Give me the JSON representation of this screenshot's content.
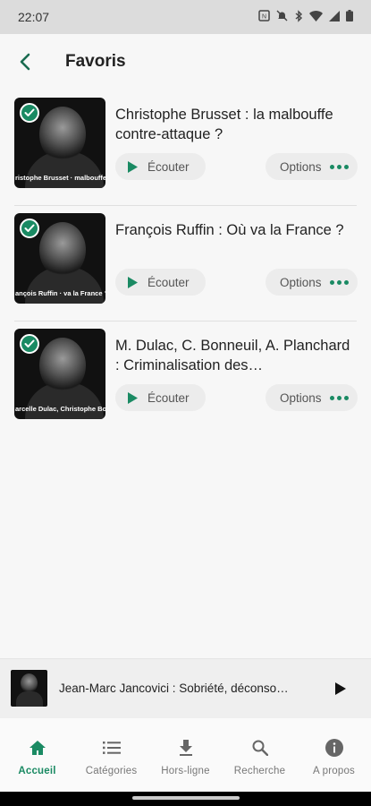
{
  "status": {
    "time": "22:07"
  },
  "header": {
    "title": "Favoris"
  },
  "items": [
    {
      "title": "Christophe Brusset : la malbouffe contre-attaque ?",
      "thumb_caption": "ristophe Brusset · malbouffe contre-attaque ?",
      "listen_label": "Écouter",
      "options_label": "Options"
    },
    {
      "title": "François Ruffin : Où va la France ?",
      "thumb_caption": "ançois Ruffin · va la France ?",
      "listen_label": "Écouter",
      "options_label": "Options"
    },
    {
      "title": "M. Dulac, C. Bonneuil, A. Planchard : Criminalisation des…",
      "thumb_caption": "arcelle Dulac, Christophe Bonneuil et Adé · des luttes écologistes ?",
      "listen_label": "Écouter",
      "options_label": "Options"
    }
  ],
  "player": {
    "title": "Jean-Marc Jancovici : Sobriété, déconso…"
  },
  "nav": [
    {
      "label": "Accueil",
      "icon": "home-icon",
      "active": true
    },
    {
      "label": "Catégories",
      "icon": "list-icon",
      "active": false
    },
    {
      "label": "Hors-ligne",
      "icon": "download-icon",
      "active": false
    },
    {
      "label": "Recherche",
      "icon": "search-icon",
      "active": false
    },
    {
      "label": "A propos",
      "icon": "info-icon",
      "active": false
    }
  ],
  "colors": {
    "accent": "#1a8a63",
    "background": "#f7f7f7"
  }
}
